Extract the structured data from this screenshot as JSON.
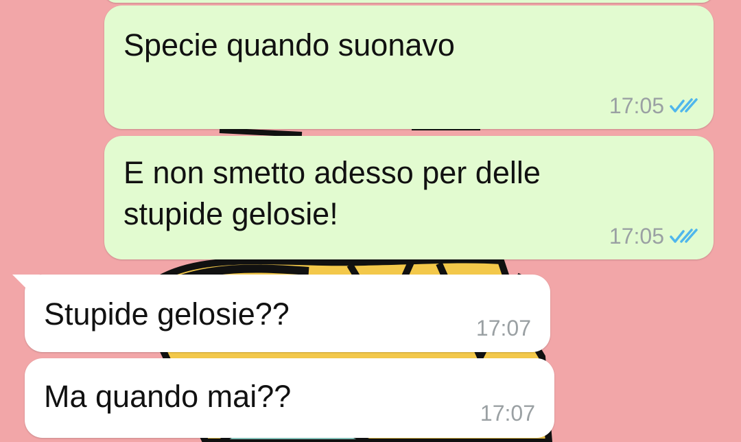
{
  "chat": {
    "background_color": "#f2a6a8",
    "outgoing_color": "#e2fbd0",
    "incoming_color": "#ffffff",
    "messages": [
      {
        "direction": "out",
        "text": "Specie quando suonavo",
        "time": "17:05",
        "status": "read",
        "status_icon": "double-check-icon"
      },
      {
        "direction": "out",
        "text": "E non smetto adesso per delle\nstupide gelosie!",
        "time": "17:05",
        "status": "read",
        "status_icon": "double-check-icon"
      },
      {
        "direction": "in",
        "text": "Stupide gelosie??",
        "time": "17:07"
      },
      {
        "direction": "in",
        "text": "Ma quando mai??",
        "time": "17:07"
      }
    ]
  }
}
